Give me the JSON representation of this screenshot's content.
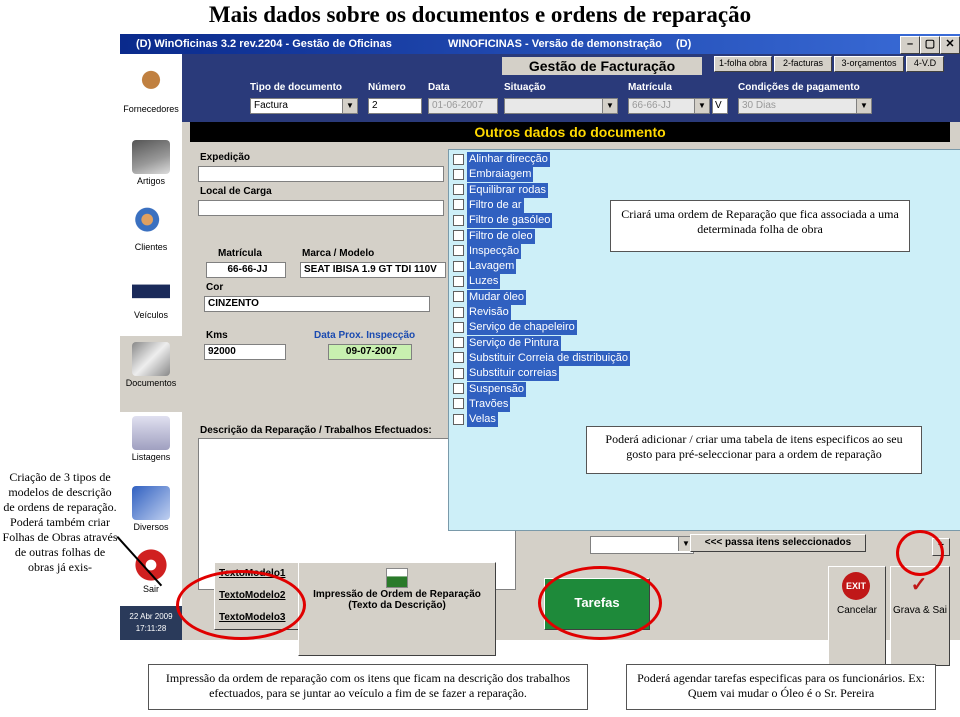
{
  "page": {
    "title": "Mais dados sobre os documentos e ordens de reparação"
  },
  "window": {
    "title_left": "(D) WinOficinas 3.2 rev.2204 - Gestão de Oficinas",
    "title_mid": "WINOFICINAS - Versão de demonstração",
    "title_right": "(D)",
    "btn_min": "–",
    "btn_max": "▢",
    "btn_close": "✕"
  },
  "sidebar": {
    "items": [
      {
        "label": "Fornecedores",
        "icon": "supplier-icon"
      },
      {
        "label": "Artigos",
        "icon": "articles-icon"
      },
      {
        "label": "Clientes",
        "icon": "clients-icon"
      },
      {
        "label": "Veículos",
        "icon": "vehicle-icon"
      },
      {
        "label": "Documentos",
        "icon": "documents-icon"
      },
      {
        "label": "Listagens",
        "icon": "listings-icon"
      },
      {
        "label": "Diversos",
        "icon": "misc-icon"
      },
      {
        "label": "Sair",
        "icon": "exit-icon"
      }
    ],
    "date": "22 Abr 2009",
    "time": "17:11:28"
  },
  "header": {
    "title": "Gestão de Facturação",
    "tabs": [
      "1-folha obra",
      "2-facturas",
      "3-orçamentos",
      "4-V.D"
    ],
    "fields": {
      "tipo_label": "Tipo de documento",
      "tipo_value": "Factura",
      "numero_label": "Número",
      "numero_value": "2",
      "data_label": "Data",
      "data_value": "01-06-2007",
      "situacao_label": "Situação",
      "situacao_value": "",
      "matricula_label": "Matrícula",
      "matricula_value": "66-66-JJ",
      "matricula_suffix": "V",
      "condicoes_label": "Condições de pagamento",
      "condicoes_value": "30 Dias"
    }
  },
  "dialog": {
    "title": "Outros dados do documento",
    "expedicao_label": "Expedição",
    "local_carga_label": "Local de Carga",
    "matricula_label": "Matrícula",
    "matricula_value": "66-66-JJ",
    "marca_label": "Marca / Modelo",
    "marca_value": "SEAT IBISA 1.9 GT TDI 110V",
    "cor_label": "Cor",
    "cor_value": "CINZENTO",
    "kms_label": "Kms",
    "kms_value": "92000",
    "inspecao_label": "Data Prox. Inspecção",
    "inspecao_value": "09-07-2007",
    "descricao_label": "Descrição da Reparação / Trabalhos Efectuados:",
    "items": [
      "Alinhar direcção",
      "Embraiagem",
      "Equilibrar rodas",
      "Filtro de ar",
      "Filtro de gasóleo",
      "Filtro de oleo",
      "Inspecção",
      "Lavagem",
      "Luzes",
      "Mudar óleo",
      "Revisão",
      "Serviço de chapeleiro",
      "Serviço de Pintura",
      "Substituir Correia de distribuição",
      "Substituir correias",
      "Suspensão",
      "Travões",
      "Velas"
    ],
    "pass_button": "<<< passa itens seleccionados",
    "add_button": "+",
    "texto_modelos": [
      "TextoModelo1",
      "TextoModelo2",
      "TextoModelo3"
    ],
    "print_button_line1": "Impressão de Ordem de Reparação",
    "print_button_line2": "(Texto da Descrição)",
    "tarefas_button": "Tarefas",
    "cancel_button": "Cancelar",
    "cancel_icon_text": "EXIT",
    "save_button": "Grava & Sai"
  },
  "callouts": {
    "ordem": "Criará uma ordem de Reparação que fica associada a uma determinada folha de obra",
    "tabela": "Poderá adicionar / criar uma tabela de itens especificos ao seu gosto para pré-seleccionar para a ordem de reparação",
    "modelos": "Criação de 3 tipos de modelos de descrição de ordens de reparação. Poderá também criar Folhas de Obras através de outras folhas de obras já exis-",
    "impressao": "Impressão da ordem de reparação com os itens que ficam na descrição dos trabalhos efectuados, para se juntar ao veículo a fim de se fazer a reparação.",
    "tarefas": "Poderá agendar tarefas especificas para os funcionários. Ex: Quem vai mudar o Óleo é o Sr. Pereira"
  },
  "colors": {
    "accent_red": "#e00000",
    "tarefas_green": "#1e8a3a",
    "title_yellow": "#ffd800",
    "list_bg": "#cdeff8"
  }
}
